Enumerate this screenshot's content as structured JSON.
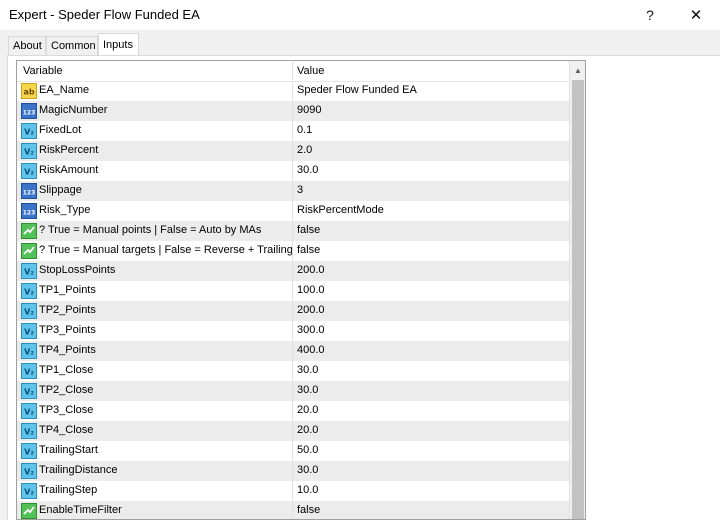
{
  "window": {
    "title": "Expert - Speder Flow Funded EA",
    "help_label": "?",
    "close_label": "✕"
  },
  "tabs": [
    {
      "label": "About",
      "active": false
    },
    {
      "label": "Common",
      "active": false
    },
    {
      "label": "Inputs",
      "active": true
    }
  ],
  "grid": {
    "col_variable": "Variable",
    "col_value": "Value",
    "rows": [
      {
        "icon": "string-icon",
        "name": "EA_Name",
        "value": "Speder Flow Funded EA"
      },
      {
        "icon": "integer-icon",
        "name": "MagicNumber",
        "value": "9090"
      },
      {
        "icon": "double-icon",
        "name": "FixedLot",
        "value": "0.1"
      },
      {
        "icon": "double-icon",
        "name": "RiskPercent",
        "value": "2.0"
      },
      {
        "icon": "double-icon",
        "name": "RiskAmount",
        "value": "30.0"
      },
      {
        "icon": "integer-icon",
        "name": "Slippage",
        "value": "3"
      },
      {
        "icon": "enum-icon",
        "name": "Risk_Type",
        "value": "RiskPercentMode"
      },
      {
        "icon": "bool-icon",
        "name": "? True = Manual points | False = Auto by MAs",
        "value": "false"
      },
      {
        "icon": "bool-icon",
        "name": "? True = Manual targets | False = Reverse + Trailing",
        "value": "false"
      },
      {
        "icon": "double-icon",
        "name": "StopLossPoints",
        "value": "200.0"
      },
      {
        "icon": "double-icon",
        "name": "TP1_Points",
        "value": "100.0"
      },
      {
        "icon": "double-icon",
        "name": "TP2_Points",
        "value": "200.0"
      },
      {
        "icon": "double-icon",
        "name": "TP3_Points",
        "value": "300.0"
      },
      {
        "icon": "double-icon",
        "name": "TP4_Points",
        "value": "400.0"
      },
      {
        "icon": "double-icon",
        "name": "TP1_Close",
        "value": "30.0"
      },
      {
        "icon": "double-icon",
        "name": "TP2_Close",
        "value": "30.0"
      },
      {
        "icon": "double-icon",
        "name": "TP3_Close",
        "value": "20.0"
      },
      {
        "icon": "double-icon",
        "name": "TP4_Close",
        "value": "20.0"
      },
      {
        "icon": "double-icon",
        "name": "TrailingStart",
        "value": "50.0"
      },
      {
        "icon": "double-icon",
        "name": "TrailingDistance",
        "value": "30.0"
      },
      {
        "icon": "double-icon",
        "name": "TrailingStep",
        "value": "10.0"
      },
      {
        "icon": "bool-icon",
        "name": "EnableTimeFilter",
        "value": "false"
      }
    ]
  },
  "icons": {
    "string-icon": {
      "text": "ab",
      "bg": "#f6d54a",
      "fg": "#6b4a00",
      "border": "#c9a21d"
    },
    "integer-icon": {
      "text": "123",
      "bg": "#3a74c9",
      "fg": "#ffffff",
      "border": "#1e4f99"
    },
    "double-icon": {
      "text": "V₂",
      "bg": "#5fc4ea",
      "fg": "#0d4e7a",
      "border": "#2a8fbd"
    },
    "enum-icon": {
      "text": "123",
      "bg": "#3a74c9",
      "fg": "#ffffff",
      "border": "#1e4f99"
    },
    "bool-icon": {
      "text": "",
      "bg": "#54c05a",
      "fg": "#ffffff",
      "border": "#2e8f35"
    }
  },
  "scroll_up_glyph": "▲"
}
